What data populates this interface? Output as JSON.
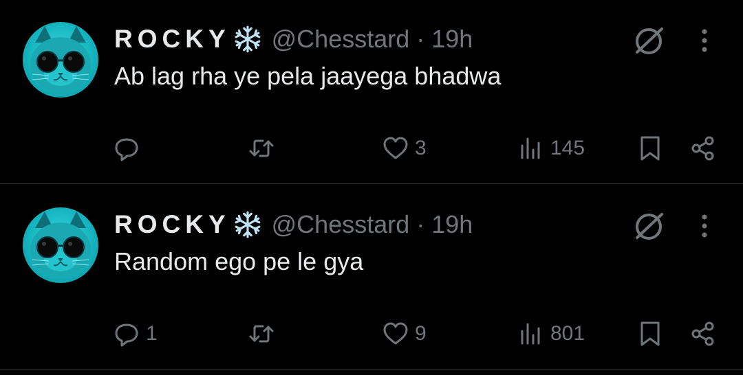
{
  "colors": {
    "background": "#000000",
    "text": "#e7e9ea",
    "muted": "#71767b",
    "divider": "#2f3336",
    "avatar": "#16b6c1",
    "snowflake": "#bfe3f5"
  },
  "tweets": [
    {
      "name": "ROCKY",
      "badge_icon": "snowflake-icon",
      "handle": "@Chesstard",
      "separator": "·",
      "time": "19h",
      "text": "Ab lag rha ye pela jaayega bhadwa",
      "replies": "",
      "retweets": "",
      "likes": "3",
      "views": "145"
    },
    {
      "name": "ROCKY",
      "badge_icon": "snowflake-icon",
      "handle": "@Chesstard",
      "separator": "·",
      "time": "19h",
      "text": "Random ego pe le gya",
      "replies": "1",
      "retweets": "",
      "likes": "9",
      "views": "801"
    }
  ],
  "icons": {
    "avatar": "cat-with-sunglasses-avatar",
    "grok": "grok-icon",
    "more": "more-icon",
    "reply": "reply-icon",
    "retweet": "retweet-icon",
    "like": "heart-icon",
    "views": "views-icon",
    "bookmark": "bookmark-icon",
    "share": "share-icon"
  }
}
